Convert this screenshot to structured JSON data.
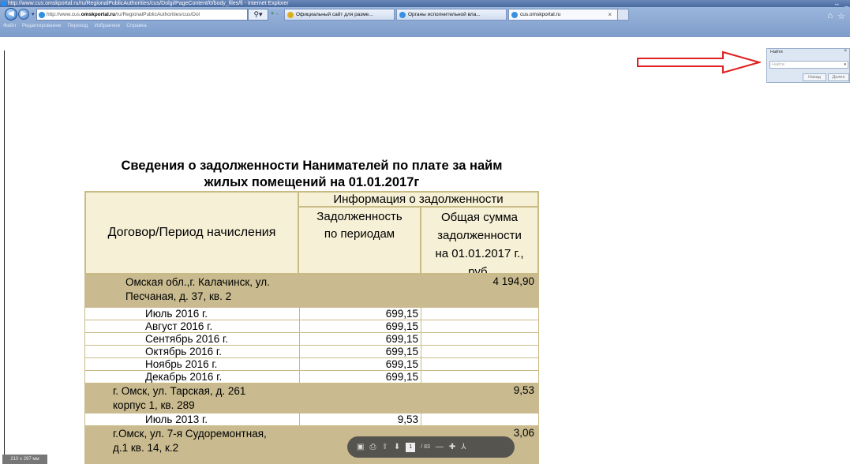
{
  "window": {
    "title": "http://www.cus.omskportal.ru/ru/RegionalPublicAuthorities/cus/Dolgi/PageContent/0/body_files/fi - Internet Explorer"
  },
  "nav": {
    "address_prefix": "http://www.cus.",
    "address_domain": "omskportal.ru",
    "address_rest": "/ru/RegionalPublicAuthorities/cus/Dol",
    "tabs": [
      {
        "label": "Официальный сайт для разме..."
      },
      {
        "label": "Органы исполнительной вла..."
      },
      {
        "label": "cus.omskportal.ru"
      }
    ]
  },
  "menu": [
    "Файл",
    "Редактирование",
    "Переход",
    "Избранное",
    "Справка"
  ],
  "find": {
    "title": "Найти",
    "placeholder": "Найти",
    "prev": "Назад",
    "next": "Далее"
  },
  "document": {
    "title_line1": "Сведения о задолженности Нанимателей по плате за найм",
    "title_line2": "жилых помещений на 01.01.2017г",
    "headers": {
      "col1": "Договор/Период начисления",
      "group": "Информация о задолженности",
      "col2_line1": "Задолженность",
      "col2_line2": "по периодам",
      "col3_line1": "Общая сумма",
      "col3_line2": "задолженности",
      "col3_line3": "на 01.01.2017 г.,",
      "col3_line4": "руб."
    },
    "groups": [
      {
        "name_line1": "Омская обл.,г. Калачинск, ул.",
        "name_line2": "Песчаная, д. 37, кв. 2",
        "total": "4 194,90",
        "items": [
          {
            "period": "Июль 2016 г.",
            "amount": "699,15"
          },
          {
            "period": "Август 2016 г.",
            "amount": "699,15"
          },
          {
            "period": "Сентябрь 2016 г.",
            "amount": "699,15"
          },
          {
            "period": "Октябрь 2016 г.",
            "amount": "699,15"
          },
          {
            "period": "Ноябрь 2016 г.",
            "amount": "699,15"
          },
          {
            "period": "Декабрь 2016 г.",
            "amount": "699,15"
          }
        ]
      },
      {
        "name_line1": "г. Омск, ул. Тарская, д. 261",
        "name_line2": "корпус 1, кв. 289",
        "total": "9,53",
        "items": [
          {
            "period": "Июль 2013 г.",
            "amount": "9,53"
          }
        ]
      },
      {
        "name_line1": "г.Омск, ул. 7-я Судоремонтная,",
        "name_line2": "д.1 кв. 14, к.2",
        "total": "3,06",
        "items": []
      }
    ]
  },
  "pdf_toolbar": {
    "page": "1",
    "total": "/ 83"
  },
  "page_size_label": "210 x 297 мм"
}
